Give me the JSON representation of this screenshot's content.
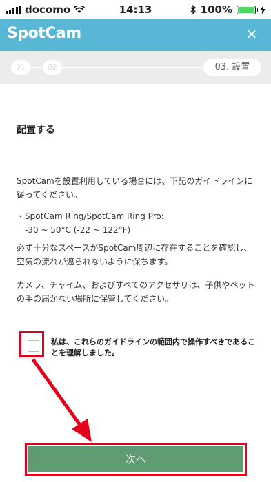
{
  "status_bar": {
    "carrier": "docomo",
    "time": "14:13",
    "battery": "100%"
  },
  "header": {
    "logo": "SpotCam",
    "close": "×"
  },
  "steps": {
    "step1": "01",
    "step2": "02",
    "current": "03. 設置"
  },
  "content": {
    "title": "配置する",
    "para1": "SpotCamを設置利用している場合には、下記のガイドラインに従ってください。",
    "para2_line1": "・SpotCam Ring/SpotCam Ring Pro:",
    "para2_line2": "　-30 ~ 50°C (-22 ~ 122°F)",
    "para3": "必ず十分なスペースがSpotCam周辺に存在することを確認し、空気の流れが遮られないように保ちます。",
    "para4": "カメラ、チャイム、およびすべてのアクセサリは、子供やペットの手の届かない場所に保管してください。"
  },
  "consent": {
    "label": "私は、これらのガイドラインの範囲内で操作すべきであることを理解しました。",
    "checked": false
  },
  "next_button": {
    "label": "次へ"
  },
  "colors": {
    "header": "#59b7d6",
    "next_button": "#5f9b73",
    "highlight": "#e3001b"
  }
}
